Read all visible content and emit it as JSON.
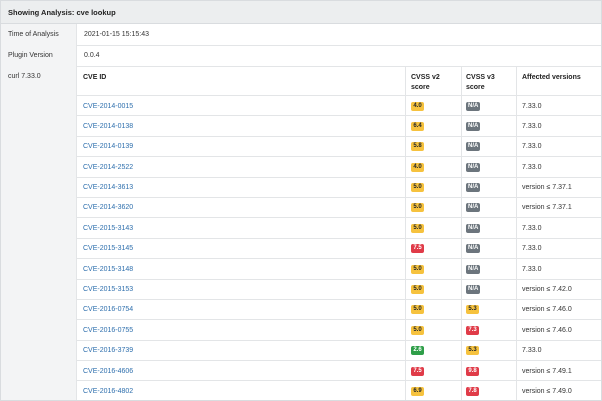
{
  "title": "Showing Analysis: cve lookup",
  "meta": [
    {
      "label": "Time of Analysis",
      "value": "2021-01-15 15:15:43"
    },
    {
      "label": "Plugin Version",
      "value": "0.0.4"
    }
  ],
  "library": "curl 7.33.0",
  "headers": {
    "cve_id": "CVE ID",
    "cvss_v2_line1": "CVSS v2",
    "cvss_v2_line2": "score",
    "cvss_v3_line1": "CVSS v3",
    "cvss_v3_line2": "score",
    "affected": "Affected versions"
  },
  "colors": {
    "warning": "#f6c23e",
    "danger": "#e03b48",
    "success": "#2e9e48",
    "na": "#6c757d",
    "link": "#2e6fad"
  },
  "rows": [
    {
      "id": "CVE-2014-0015",
      "v2": "4.0",
      "v2_level": "warning",
      "v3": "N/A",
      "v3_level": "na",
      "affected": "7.33.0"
    },
    {
      "id": "CVE-2014-0138",
      "v2": "6.4",
      "v2_level": "warning",
      "v3": "N/A",
      "v3_level": "na",
      "affected": "7.33.0"
    },
    {
      "id": "CVE-2014-0139",
      "v2": "5.8",
      "v2_level": "warning",
      "v3": "N/A",
      "v3_level": "na",
      "affected": "7.33.0"
    },
    {
      "id": "CVE-2014-2522",
      "v2": "4.0",
      "v2_level": "warning",
      "v3": "N/A",
      "v3_level": "na",
      "affected": "7.33.0"
    },
    {
      "id": "CVE-2014-3613",
      "v2": "5.0",
      "v2_level": "warning",
      "v3": "N/A",
      "v3_level": "na",
      "affected": "version ≤ 7.37.1"
    },
    {
      "id": "CVE-2014-3620",
      "v2": "5.0",
      "v2_level": "warning",
      "v3": "N/A",
      "v3_level": "na",
      "affected": "version ≤ 7.37.1"
    },
    {
      "id": "CVE-2015-3143",
      "v2": "5.0",
      "v2_level": "warning",
      "v3": "N/A",
      "v3_level": "na",
      "affected": "7.33.0"
    },
    {
      "id": "CVE-2015-3145",
      "v2": "7.5",
      "v2_level": "danger",
      "v3": "N/A",
      "v3_level": "na",
      "affected": "7.33.0"
    },
    {
      "id": "CVE-2015-3148",
      "v2": "5.0",
      "v2_level": "warning",
      "v3": "N/A",
      "v3_level": "na",
      "affected": "7.33.0"
    },
    {
      "id": "CVE-2015-3153",
      "v2": "5.0",
      "v2_level": "warning",
      "v3": "N/A",
      "v3_level": "na",
      "affected": "version ≤ 7.42.0"
    },
    {
      "id": "CVE-2016-0754",
      "v2": "5.0",
      "v2_level": "warning",
      "v3": "5.3",
      "v3_level": "warning",
      "affected": "version ≤ 7.46.0"
    },
    {
      "id": "CVE-2016-0755",
      "v2": "5.0",
      "v2_level": "warning",
      "v3": "7.3",
      "v3_level": "danger",
      "affected": "version ≤ 7.46.0"
    },
    {
      "id": "CVE-2016-3739",
      "v2": "2.6",
      "v2_level": "success",
      "v3": "5.3",
      "v3_level": "warning",
      "affected": "7.33.0"
    },
    {
      "id": "CVE-2016-4606",
      "v2": "7.5",
      "v2_level": "danger",
      "v3": "9.8",
      "v3_level": "danger",
      "affected": "version ≤ 7.49.1"
    },
    {
      "id": "CVE-2016-4802",
      "v2": "6.9",
      "v2_level": "warning",
      "v3": "7.8",
      "v3_level": "danger",
      "affected": "version ≤ 7.49.0"
    }
  ]
}
